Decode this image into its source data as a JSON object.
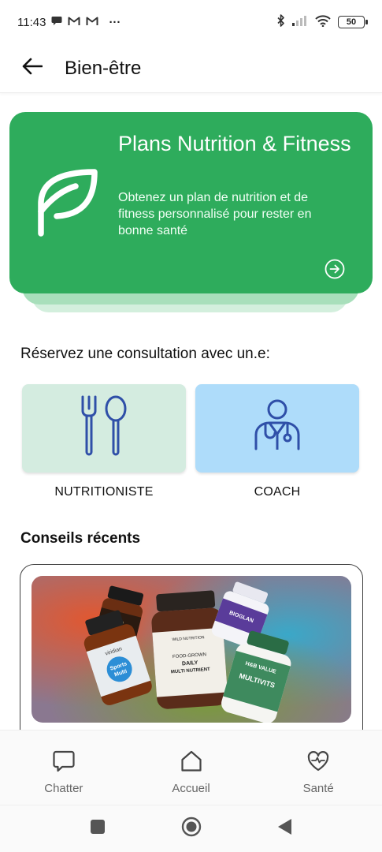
{
  "status_bar": {
    "time": "11:43",
    "more": "···",
    "battery": "50",
    "icons": [
      "chat-bubble-icon",
      "gmail-icon",
      "gmail-icon",
      "bluetooth-icon",
      "cellular-signal-icon",
      "wifi-icon",
      "battery-icon"
    ]
  },
  "header": {
    "back_icon": "arrow-left-icon",
    "title": "Bien-être"
  },
  "hero": {
    "title": "Plans Nutrition & Fitness",
    "description": "Obtenez un plan de nutrition et de fitness personnalisé pour rester en bonne santé",
    "icon": "leaf-icon",
    "action_icon": "arrow-circle-right-icon",
    "color": "#2EAC5C"
  },
  "consultation": {
    "heading": "Réservez une consultation avec un.e:",
    "options": [
      {
        "label": "NUTRITIONISTE",
        "icon": "fork-spoon-icon",
        "color": "#D4ECE0"
      },
      {
        "label": "COACH",
        "icon": "doctor-icon",
        "color": "#AEDCFA"
      }
    ]
  },
  "tips": {
    "heading": "Conseils récents",
    "items": [
      {
        "image": "supplement-bottles-image",
        "image_texts": [
          "viridian",
          "Sports Multi",
          "WILD NUTRITION",
          "FOOD-GROWN",
          "DAILY",
          "MULTI NUTRIENT",
          "BIOGLAN",
          "H&B VALUE",
          "MULTIVITS"
        ]
      }
    ]
  },
  "bottom_nav": {
    "items": [
      {
        "label": "Chatter",
        "icon": "chat-icon"
      },
      {
        "label": "Accueil",
        "icon": "home-icon"
      },
      {
        "label": "Santé",
        "icon": "heart-pulse-icon"
      }
    ]
  },
  "system_nav": {
    "icons": [
      "recent-apps-icon",
      "home-circle-icon",
      "back-triangle-icon"
    ]
  }
}
